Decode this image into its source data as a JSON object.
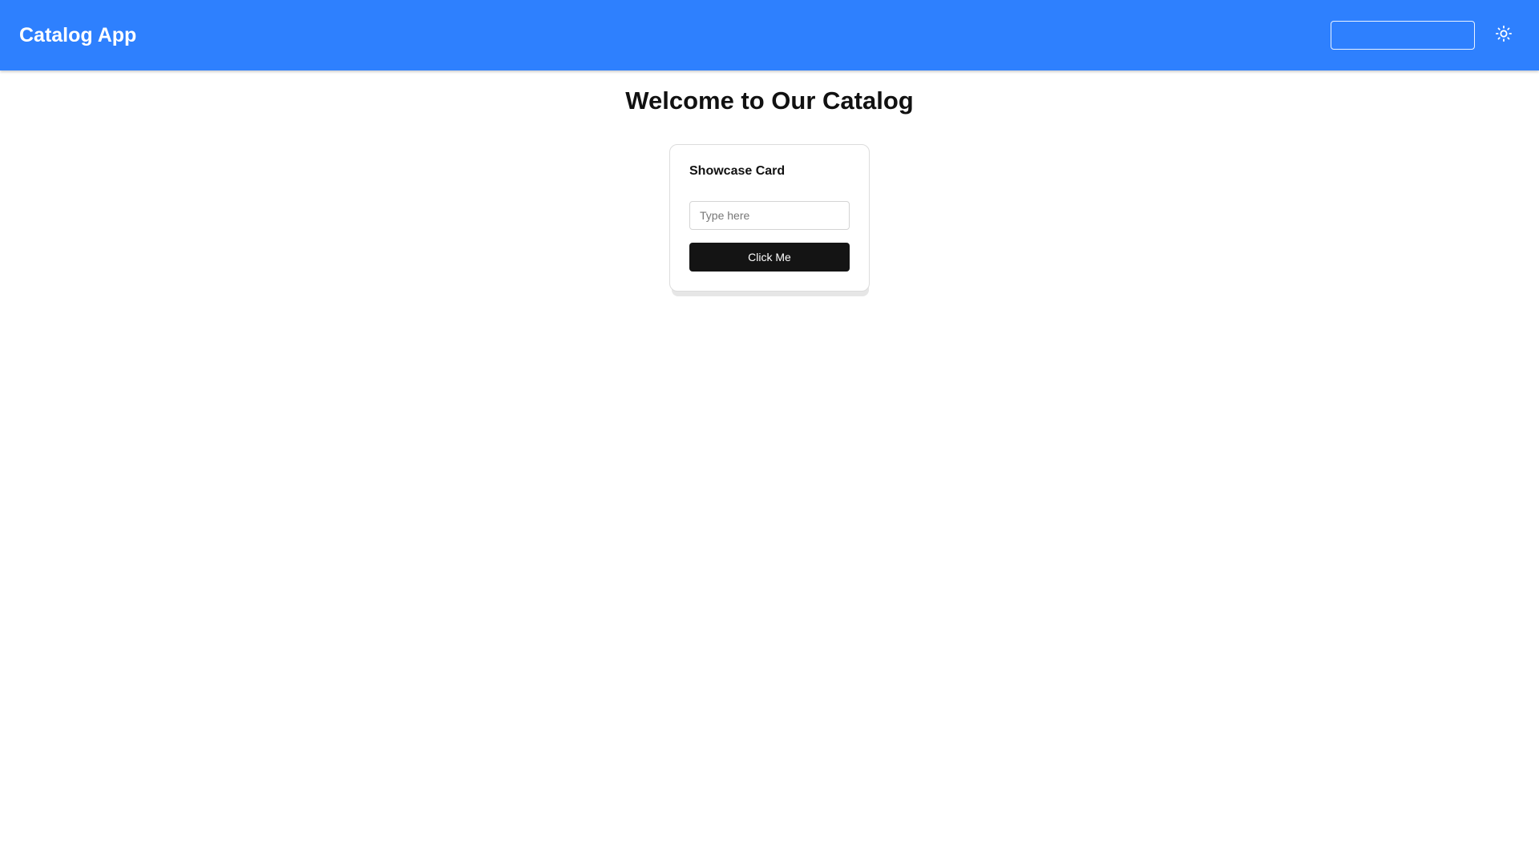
{
  "app": {
    "title": "Catalog App",
    "accent_color": "#2e80fe"
  },
  "header": {
    "search": {
      "value": "",
      "placeholder": ""
    },
    "theme_toggle_icon": "sun-icon"
  },
  "main": {
    "title": "Welcome to Our Catalog",
    "card": {
      "title": "Showcase Card",
      "input": {
        "value": "",
        "placeholder": "Type here"
      },
      "button_label": "Click Me",
      "button_color": "#141414"
    }
  }
}
